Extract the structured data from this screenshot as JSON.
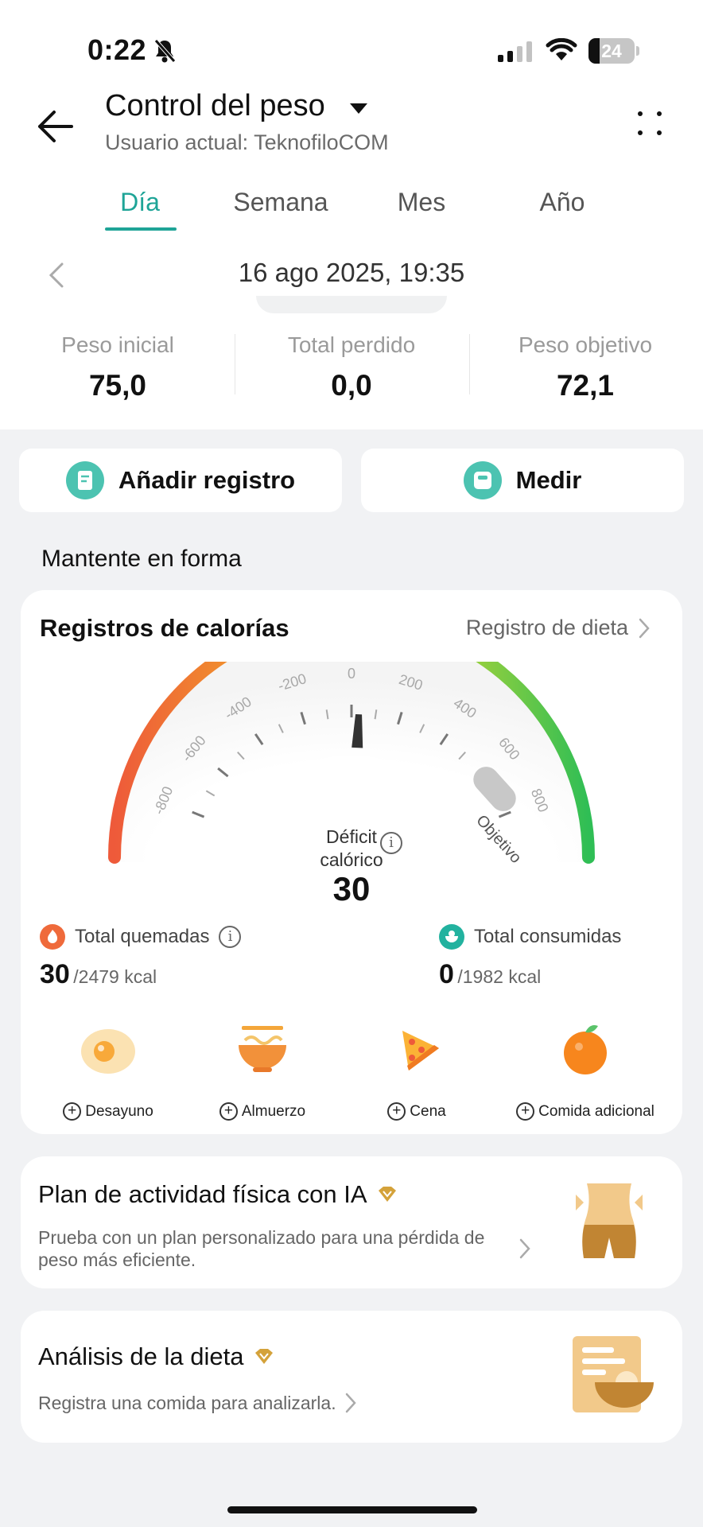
{
  "status_bar": {
    "time": "0:22",
    "battery": "24"
  },
  "header": {
    "title": "Control del peso",
    "subtitle": "Usuario actual: TeknofiloCOM"
  },
  "tabs": [
    {
      "label": "Día",
      "active": true
    },
    {
      "label": "Semana",
      "active": false
    },
    {
      "label": "Mes",
      "active": false
    },
    {
      "label": "Año",
      "active": false
    }
  ],
  "date": "16 ago 2025, 19:35",
  "stats": [
    {
      "label": "Peso inicial",
      "value": "75,0"
    },
    {
      "label": "Total perdido",
      "value": "0,0"
    },
    {
      "label": "Peso objetivo",
      "value": "72,1"
    }
  ],
  "actions": {
    "add_record": "Añadir registro",
    "measure": "Medir"
  },
  "section_title": "Mantente en forma",
  "calories": {
    "title": "Registros de calorías",
    "diet_link": "Registro de dieta",
    "gauge_ticks": [
      "-800",
      "-600",
      "-400",
      "-200",
      "0",
      "200",
      "400",
      "600",
      "800"
    ],
    "gauge_value": 30,
    "target_label": "Objetivo",
    "deficit_label_1": "Déficit",
    "deficit_label_2": "calórico",
    "deficit_value": "30",
    "burned_label": "Total quemadas",
    "burned_value": "30",
    "burned_total": "/2479 kcal",
    "consumed_label": "Total consumidas",
    "consumed_value": "0",
    "consumed_total": "/1982 kcal",
    "meals": [
      "Desayuno",
      "Almuerzo",
      "Cena",
      "Comida adicional"
    ]
  },
  "ai_plan": {
    "title": "Plan de actividad física con IA",
    "description": "Prueba con un plan personalizado para una pérdida de peso más eficiente."
  },
  "diet_analysis": {
    "title": "Análisis de la dieta",
    "description": "Registra una comida para analizarla."
  },
  "colors": {
    "accent": "#1ea497",
    "premium": "#d4a23a"
  }
}
